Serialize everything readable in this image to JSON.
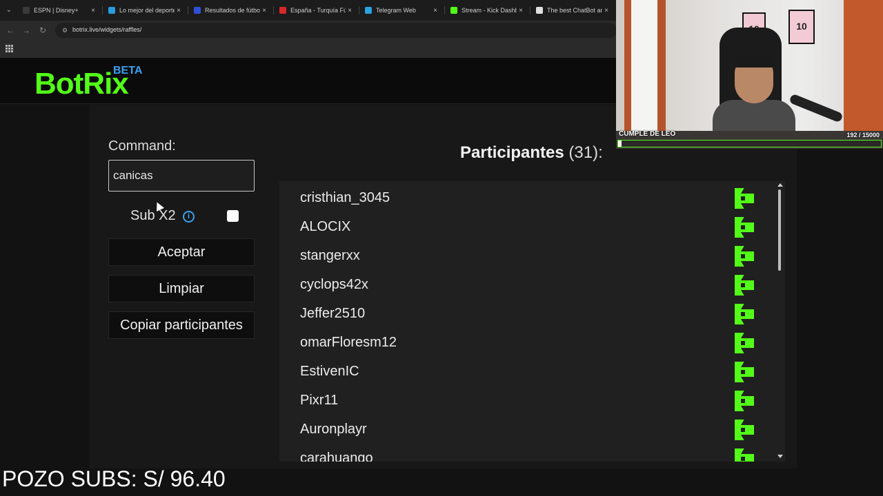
{
  "browser": {
    "tabs": [
      {
        "label": "ESPN | Disney+",
        "color": "#3a3a3a"
      },
      {
        "label": "Lo mejor del deporte",
        "color": "#2b9be0"
      },
      {
        "label": "Resultados de fútbol",
        "color": "#3050d8"
      },
      {
        "label": "España - Turquía Fútb",
        "color": "#d8272b"
      },
      {
        "label": "Telegram Web",
        "color": "#2aa3e2"
      },
      {
        "label": "Stream - Kick Dashbo",
        "color": "#53fc18"
      },
      {
        "label": "The best ChatBot an",
        "color": "#e0e0e0"
      }
    ],
    "close_glyph": "×",
    "url": "botrix.live/widgets/raffles/"
  },
  "header": {
    "logo": "BotRix",
    "beta": "BETA"
  },
  "form": {
    "command_label": "Command:",
    "command_value": "canicas",
    "subx2_label": "Sub X2",
    "info_glyph": "i",
    "subx2_checked": false,
    "accept_label": "Aceptar",
    "clear_label": "Limpiar",
    "copy_label": "Copiar participantes"
  },
  "participants": {
    "title": "Participantes",
    "count": "(31):",
    "items": [
      "cristhian_3045",
      "ALOCIX",
      "stangerxx",
      "cyclops42x",
      "Jeffer2510",
      "omarFloresm12",
      "EstivenIC",
      "Pixr11",
      "Auronplayr",
      "carahuango"
    ],
    "platform_icon": "kick-icon",
    "accent": "#53fc18"
  },
  "webcam": {
    "caption": "CUMPLE DE LEO",
    "progress_text": "192 / 15000",
    "progress_value": 0.0128,
    "poster1_text": "10",
    "poster2_text": "10"
  },
  "overlay": {
    "pozo": "POZO SUBS: S/ 96.40"
  },
  "colors": {
    "brand_green": "#53fc18",
    "beta_blue": "#3aa0f0"
  }
}
